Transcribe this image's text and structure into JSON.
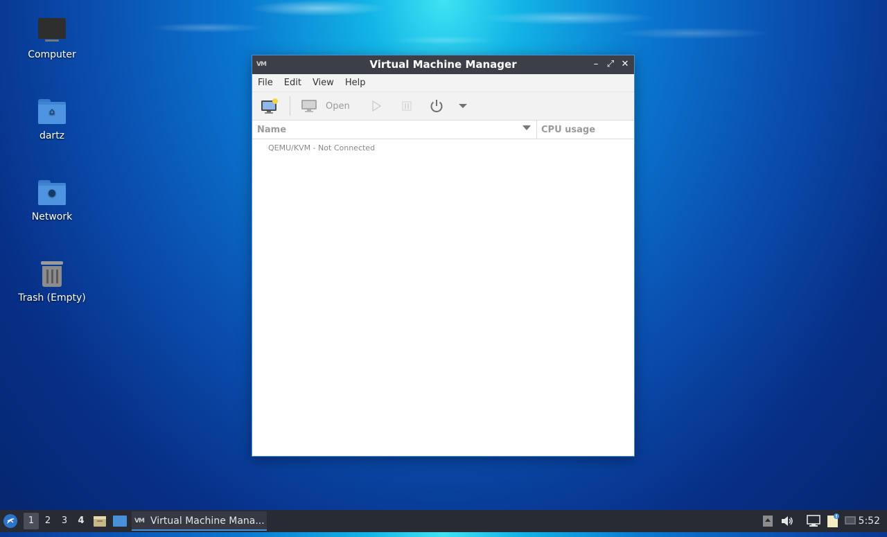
{
  "desktop": {
    "icons": [
      {
        "label": "Computer",
        "icon": "computer-icon"
      },
      {
        "label": "dartz",
        "icon": "home-folder-icon"
      },
      {
        "label": "Network",
        "icon": "network-folder-icon"
      },
      {
        "label": "Trash (Empty)",
        "icon": "trash-icon"
      }
    ]
  },
  "window": {
    "title": "Virtual Machine Manager",
    "app_icon": "VM",
    "controls": [
      "–",
      "⤢",
      "✕"
    ],
    "menu": [
      "File",
      "Edit",
      "View",
      "Help"
    ],
    "toolbar": {
      "new_vm_icon": "new-vm-icon",
      "open_label": "Open",
      "run_icon": "play-icon",
      "pause_icon": "pause-icon",
      "power_icon": "power-icon",
      "dropdown_icon": "chevron-down-icon"
    },
    "columns": {
      "name": "Name",
      "cpu": "CPU usage"
    },
    "rows": [
      {
        "name": "QEMU/KVM - Not Connected"
      }
    ]
  },
  "taskbar": {
    "workspaces": [
      "1",
      "2",
      "3",
      "4"
    ],
    "active_workspace": "1",
    "task_label": "Virtual Machine Mana...",
    "task_icon": "VM",
    "clock": "5:52",
    "accent": "#4a90d9"
  }
}
